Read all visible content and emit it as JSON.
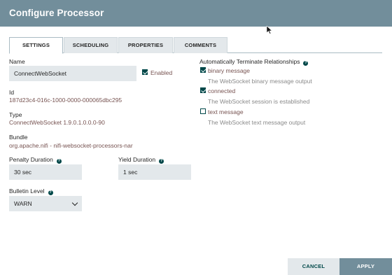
{
  "header": {
    "title": "Configure Processor"
  },
  "tabs": [
    {
      "label": "SETTINGS"
    },
    {
      "label": "SCHEDULING"
    },
    {
      "label": "PROPERTIES"
    },
    {
      "label": "COMMENTS"
    }
  ],
  "settings": {
    "name_label": "Name",
    "name_value": "ConnectWebSocket",
    "enabled_label": "Enabled",
    "enabled": true,
    "id_label": "Id",
    "id_value": "187d23c4-016c-1000-0000-000065dbc295",
    "type_label": "Type",
    "type_value": "ConnectWebSocket 1.9.0.1.0.0.0-90",
    "bundle_label": "Bundle",
    "bundle_value": "org.apache.nifi - nifi-websocket-processors-nar",
    "penalty_label": "Penalty Duration",
    "penalty_value": "30 sec",
    "yield_label": "Yield Duration",
    "yield_value": "1 sec",
    "bulletin_label": "Bulletin Level",
    "bulletin_value": "WARN"
  },
  "relationships": {
    "title": "Automatically Terminate Relationships",
    "items": [
      {
        "name": "binary message",
        "description": "The WebSocket binary message output",
        "checked": true
      },
      {
        "name": "connected",
        "description": "The WebSocket session is established",
        "checked": true
      },
      {
        "name": "text message",
        "description": "The WebSocket text message output",
        "checked": false
      }
    ]
  },
  "footer": {
    "cancel_label": "CANCEL",
    "apply_label": "APPLY"
  },
  "icons": {
    "info": "info-icon",
    "checkbox": "checkbox-icon",
    "chevron": "chevron-down-icon",
    "cursor": "mouse-cursor-icon"
  },
  "colors": {
    "header": "#728e9b",
    "accent": "#004849",
    "value_text": "#775351",
    "field_bg": "#e3e8eb"
  }
}
